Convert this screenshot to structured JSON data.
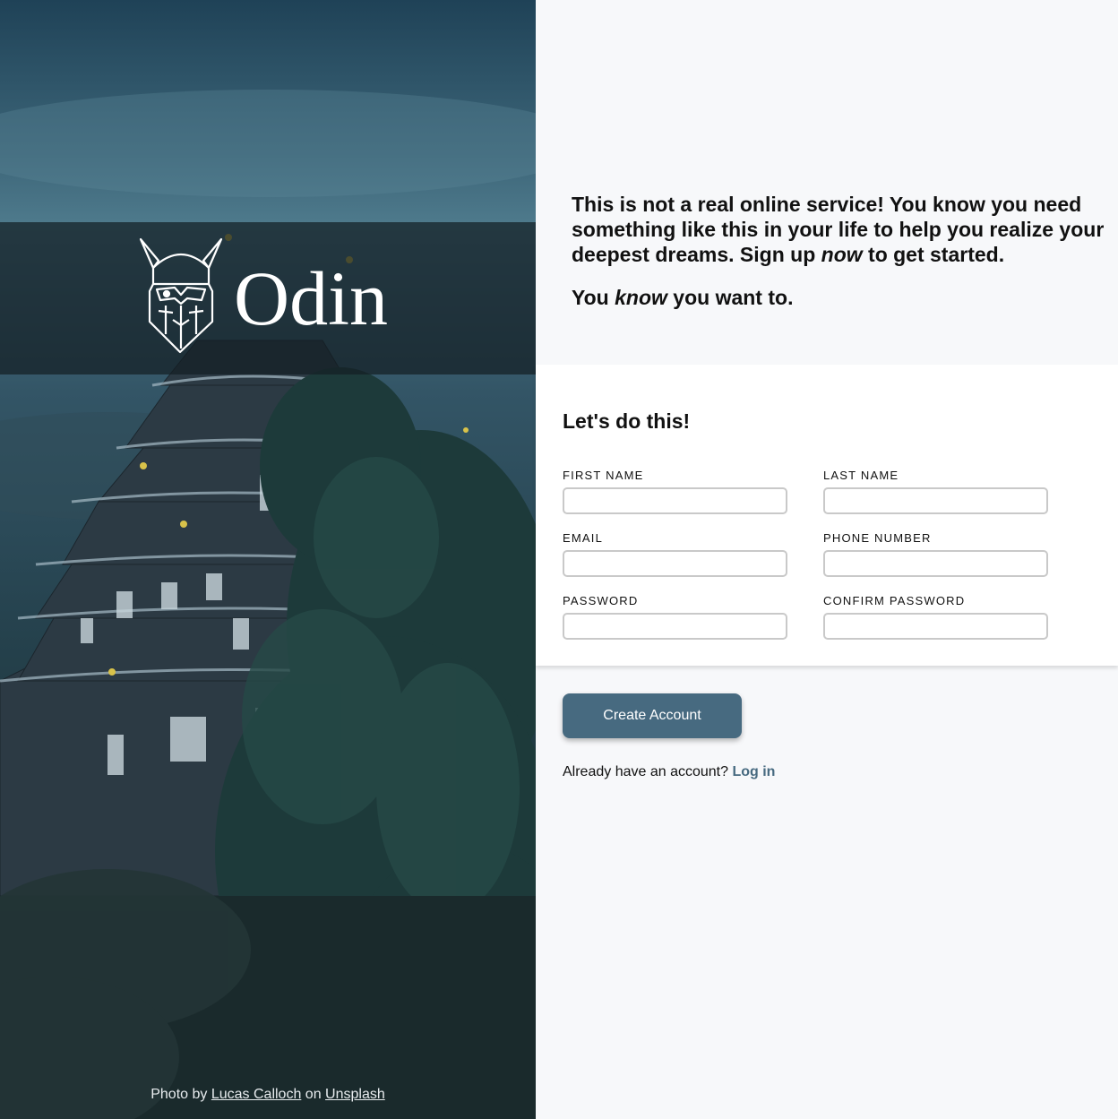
{
  "hero": {
    "logo_text": "Odin",
    "credit": {
      "prefix": "Photo by",
      "author": "Lucas Calloch",
      "middle": "on",
      "site": "Unsplash"
    }
  },
  "intro": {
    "line1_a": "This is not a real online service! You know you need something like this in your life to help you realize your deepest dreams. Sign up ",
    "line1_em": "now",
    "line1_b": " to get started.",
    "line2_a": "You ",
    "line2_em": "know",
    "line2_b": " you want to."
  },
  "form": {
    "title": "Let's do this!",
    "fields": {
      "first_name": "FIRST NAME",
      "last_name": "LAST NAME",
      "email": "EMAIL",
      "phone": "PHONE NUMBER",
      "password": "PASSWORD",
      "confirm_password": "CONFIRM PASSWORD"
    }
  },
  "actions": {
    "create_account": "Create Account",
    "have_account": "Already have an account?",
    "login": "Log in"
  },
  "colors": {
    "accent": "#476a80",
    "background": "#f7f8fa",
    "card": "#ffffff"
  },
  "icons": {
    "logo": "viking-head-icon"
  }
}
